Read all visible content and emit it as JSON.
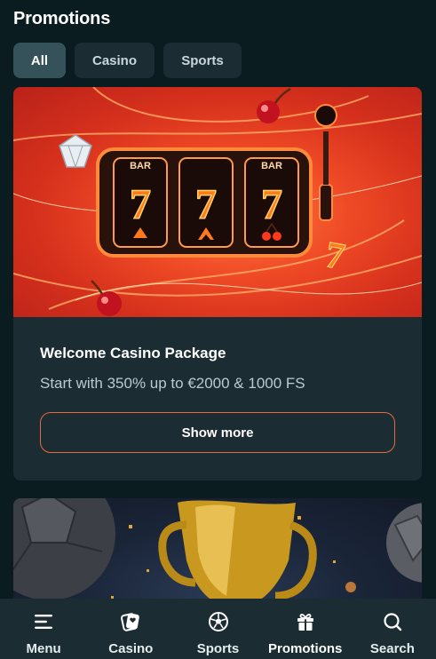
{
  "header": {
    "title": "Promotions"
  },
  "tabs": [
    {
      "label": "All",
      "active": true
    },
    {
      "label": "Casino",
      "active": false
    },
    {
      "label": "Sports",
      "active": false
    }
  ],
  "promotions": [
    {
      "title": "Welcome Casino Package",
      "subtitle": "Start with 350% up to €2000 & 1000 FS",
      "button_label": "Show more",
      "banner": {
        "icon": "slot-machine-icon",
        "reel_text": "BAR",
        "reel_symbols": [
          "7",
          "7",
          "7"
        ]
      }
    },
    {
      "banner": {
        "icon": "trophy-icon"
      }
    }
  ],
  "bottom_nav": [
    {
      "label": "Menu",
      "icon": "menu-icon",
      "active": false
    },
    {
      "label": "Casino",
      "icon": "casino-chip-icon",
      "active": false
    },
    {
      "label": "Sports",
      "icon": "soccer-ball-icon",
      "active": false
    },
    {
      "label": "Promotions",
      "icon": "gift-icon",
      "active": true
    },
    {
      "label": "Search",
      "icon": "search-icon",
      "active": false
    }
  ],
  "colors": {
    "background": "#0b1c21",
    "surface": "#1b2d33",
    "active_tab": "#35525b",
    "accent_border": "#e56a3e"
  }
}
